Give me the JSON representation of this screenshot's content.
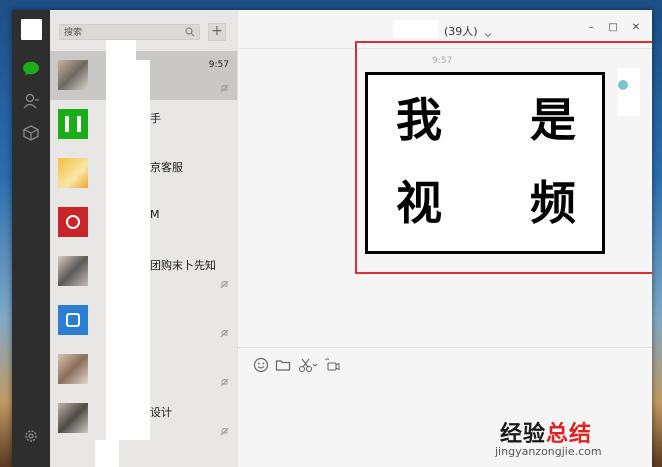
{
  "search": {
    "placeholder": "搜索"
  },
  "add_label": "+",
  "contacts": [
    {
      "name": "",
      "time": "9:57",
      "muted": true,
      "active": true
    },
    {
      "name": "手",
      "time": "",
      "muted": false
    },
    {
      "name": "京客服",
      "time": "",
      "muted": false
    },
    {
      "name": "M",
      "time": "",
      "muted": false
    },
    {
      "name": "团购末卜先知",
      "time": "",
      "muted": true
    },
    {
      "name": "",
      "time": "",
      "muted": true
    },
    {
      "name": "",
      "time": "",
      "muted": true
    },
    {
      "name": "设计",
      "time": "",
      "muted": true
    }
  ],
  "chat": {
    "title": "(39人)",
    "timestamp": "9:57",
    "video_text": [
      "我",
      "是",
      "视",
      "频"
    ]
  },
  "window_controls": {
    "min": "–",
    "max": "□",
    "close": "✕"
  },
  "watermark": {
    "part1": "经验",
    "part2": "总结",
    "url": "jingyanzongjie.com"
  },
  "colors": {
    "highlight": "#d93130",
    "nav_bg": "#2e2e2e",
    "chat_icon": "#1aad19"
  },
  "icons": [
    "chat-icon",
    "contacts-icon",
    "favorites-icon",
    "settings-icon",
    "emoji-icon",
    "folder-icon",
    "scissors-icon",
    "video-call-icon"
  ]
}
